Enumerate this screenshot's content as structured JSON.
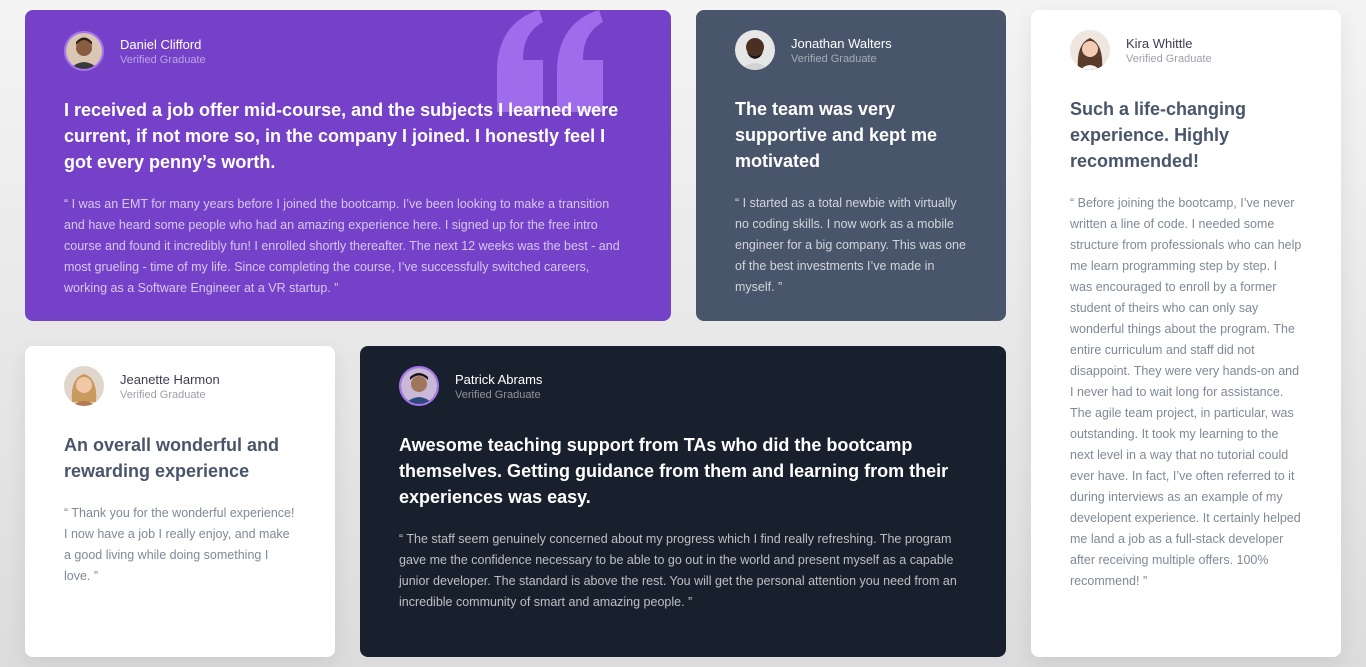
{
  "colors": {
    "purple": "#7541c8",
    "slate": "#48556a",
    "dark": "#19202d",
    "white": "#ffffff",
    "quote_mark": "#a775f1"
  },
  "testimonials": {
    "daniel": {
      "name": "Daniel Clifford",
      "role": "Verified Graduate",
      "avatar_icon": "avatar-daniel",
      "title": "I received a job offer mid-course, and the subjects I learned were current, if not more so, in the company I joined. I honestly feel I got every penny’s worth.",
      "body": "“ I was an EMT for many years before I joined the bootcamp. I’ve been looking to make a transition and have heard some people who had an amazing experience here. I signed up for the free intro course and found it incredibly fun! I enrolled shortly thereafter. The next 12 weeks was the best - and most grueling - time of my life. Since completing the course, I’ve successfully switched careers, working as a Software Engineer at a VR startup. ”"
    },
    "jonathan": {
      "name": "Jonathan Walters",
      "role": "Verified Graduate",
      "avatar_icon": "avatar-jonathan",
      "title": "The team was very supportive and kept me motivated",
      "body": "“ I started as a total newbie with virtually no coding skills. I now work as a mobile engineer for a big company. This was one of the best investments I’ve made in myself. ”"
    },
    "kira": {
      "name": "Kira Whittle",
      "role": "Verified Graduate",
      "avatar_icon": "avatar-kira",
      "title": "Such a life-changing experience. Highly recommended!",
      "body": "“ Before joining the bootcamp, I’ve never written a line of code. I needed some structure from professionals who can help me learn programming step by step. I was encouraged to enroll by a former student of theirs who can only say wonderful things about the program. The entire curriculum and staff did not disappoint. They were very hands-on and I never had to wait long for assistance. The agile team project, in particular, was outstanding. It took my learning to the next level in a way that no tutorial could ever have. In fact, I’ve often referred to it during interviews as an example of my developent experience. It certainly helped me land a job as a full-stack developer after receiving multiple offers. 100% recommend! ”"
    },
    "jeanette": {
      "name": "Jeanette Harmon",
      "role": "Verified Graduate",
      "avatar_icon": "avatar-jeanette",
      "title": "An overall wonderful and rewarding experience",
      "body": "“ Thank you for the wonderful experience! I now have a job I really enjoy, and make a good living while doing something I love. ”"
    },
    "patrick": {
      "name": "Patrick Abrams",
      "role": "Verified Graduate",
      "avatar_icon": "avatar-patrick",
      "title": "Awesome teaching support from TAs who did the bootcamp themselves. Getting guidance from them and learning from their experiences was easy.",
      "body": "“ The staff seem genuinely concerned about my progress which I find really refreshing. The program gave me the confidence necessary to be able to go out in the world and present myself as a capable junior developer. The standard is above the rest. You will get the personal attention you need from an incredible community of smart and amazing people. ”"
    }
  }
}
